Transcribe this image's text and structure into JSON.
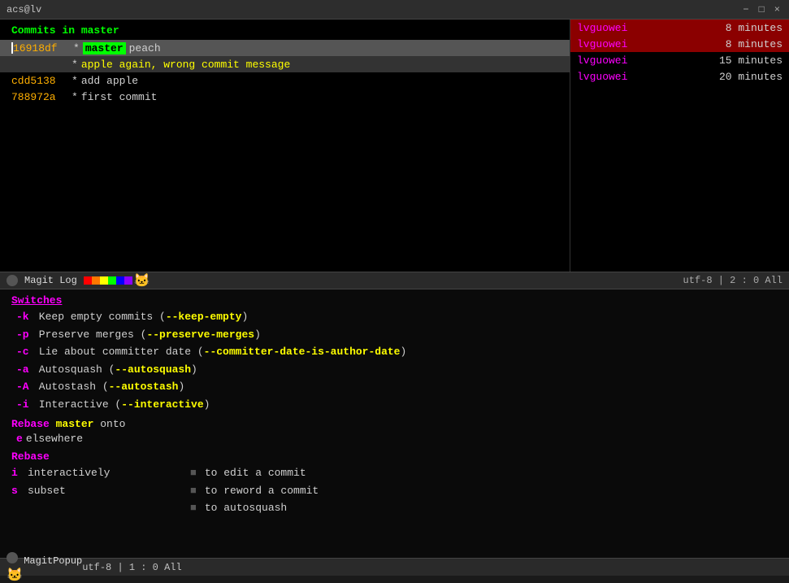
{
  "titleBar": {
    "title": "acs@lv",
    "controls": [
      "−",
      "□",
      "×"
    ]
  },
  "topPane": {
    "header": {
      "prefix": "Commits in ",
      "branch": "master"
    },
    "commits": [
      {
        "hash": "16918df",
        "star": "*",
        "branch": "master",
        "message": "peach",
        "selected": true,
        "cursor": true
      },
      {
        "hash": "",
        "star": "*",
        "branch": "",
        "message": "apple again, wrong commit message",
        "selected": true,
        "cursor": false
      },
      {
        "hash": "cdd5138",
        "star": "*",
        "branch": "",
        "message": "add apple",
        "selected": false,
        "cursor": false
      },
      {
        "hash": "788972a",
        "star": "*",
        "branch": "",
        "message": "first commit",
        "selected": false,
        "cursor": false
      }
    ],
    "rightPanel": [
      {
        "author": "lvguowei",
        "time": "8 minutes",
        "selected": true
      },
      {
        "author": "lvguowei",
        "time": "8 minutes",
        "selected": true
      },
      {
        "author": "lvguowei",
        "time": "15 minutes",
        "selected": false
      },
      {
        "author": "lvguowei",
        "time": "20 minutes",
        "selected": false
      }
    ]
  },
  "statusBar1": {
    "left": "Magit Log",
    "encoding": "utf-8",
    "position": "2 : 0",
    "percent": "All"
  },
  "bottomPane": {
    "switchesLabel": "Switches",
    "switches": [
      {
        "key": "-k",
        "text": "Keep empty commits (",
        "flag": "--keep-empty",
        "close": ")"
      },
      {
        "key": "-p",
        "text": "Preserve merges (",
        "flag": "--preserve-merges",
        "close": ")"
      },
      {
        "key": "-c",
        "text": "Lie about committer date (",
        "flag": "--committer-date-is-author-date",
        "close": ")"
      },
      {
        "key": "-a",
        "text": "Autosquash (",
        "flag": "--autosquash",
        "close": ")"
      },
      {
        "key": "-A",
        "text": "Autostash (",
        "flag": "--autostash",
        "close": ")"
      },
      {
        "key": "-i",
        "text": "Interactive (",
        "flag": "--interactive",
        "close": ")"
      }
    ],
    "rebaseOnto": {
      "label": "Rebase",
      "branch": "master",
      "onto": "onto"
    },
    "elsewhereKey": "e",
    "elsewhereText": "elsewhere",
    "rebaseLabel": "Rebase",
    "actions": [
      {
        "key": "i",
        "text": "interactively"
      },
      {
        "key": "s",
        "text": "subset"
      }
    ],
    "rightActions": [
      {
        "icon": "■",
        "text": "to edit a commit"
      },
      {
        "icon": "■",
        "text": "to reword a commit"
      },
      {
        "icon": "■",
        "text": "to autosquash"
      }
    ]
  },
  "statusBar2": {
    "left": "MagitPopup",
    "encoding": "utf-8",
    "position": "1 : 0",
    "percent": "All"
  }
}
